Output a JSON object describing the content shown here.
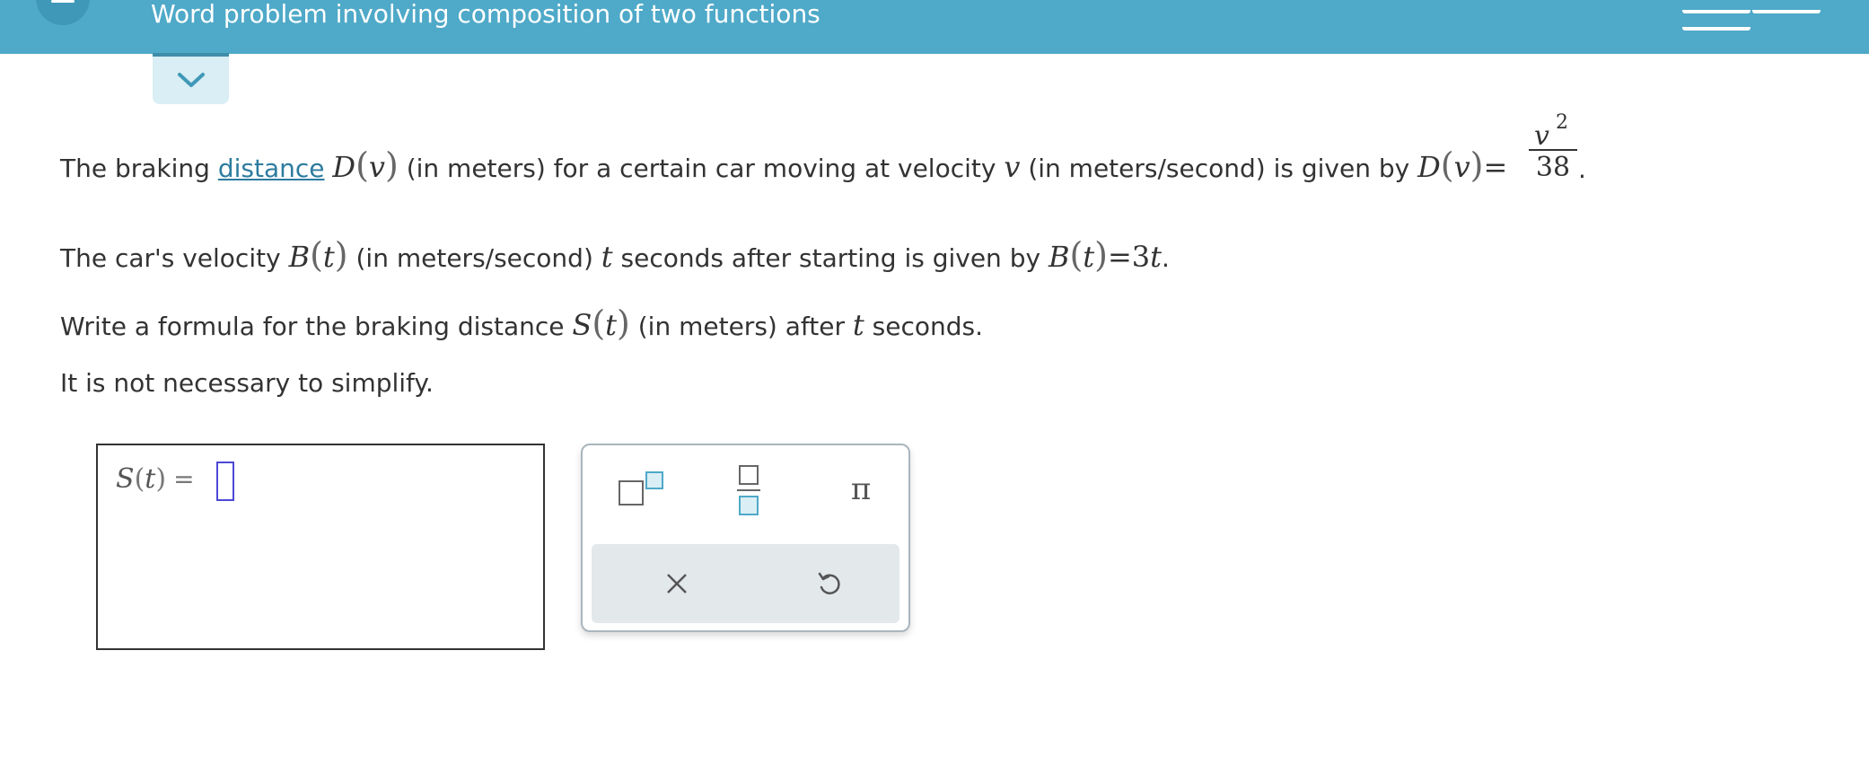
{
  "header": {
    "title": "Word problem involving composition of two functions"
  },
  "problem": {
    "line1": {
      "pre": "The braking ",
      "link": "distance",
      "D": "D",
      "v": "v",
      "mid1": " (in meters) for a certain car moving at velocity ",
      "mid2": " (in meters/second) is given by ",
      "eq": "=",
      "fraction_num_base": "v",
      "fraction_num_exp": "2",
      "fraction_den": "38",
      "end": "."
    },
    "line2": {
      "pre": "The car's velocity ",
      "B": "B",
      "t": "t",
      "mid1": " (in meters/second) ",
      "mid2": " seconds after starting is given by ",
      "eq": "=",
      "rhs_num": "3",
      "end": "."
    },
    "line3": {
      "pre": "Write a formula for the braking distance ",
      "S": "S",
      "t": "t",
      "mid1": " (in meters) after ",
      "mid2": " seconds."
    },
    "line4": "It is not necessary to simplify."
  },
  "answer": {
    "func": "S",
    "var": "t",
    "eq": "=",
    "value": ""
  },
  "keypad": {
    "pi_label": "π"
  },
  "icons": {
    "menu": "menu-icon",
    "collapse": "chevron-down-icon",
    "superscript": "superscript-template-icon",
    "fraction": "fraction-template-icon",
    "clear": "close-icon",
    "undo": "undo-icon"
  },
  "colors": {
    "header_bg": "#4fa9c8",
    "link": "#2d7c9f",
    "input_cursor": "#4b49d6",
    "keypad_template": "#4fa9c8"
  }
}
